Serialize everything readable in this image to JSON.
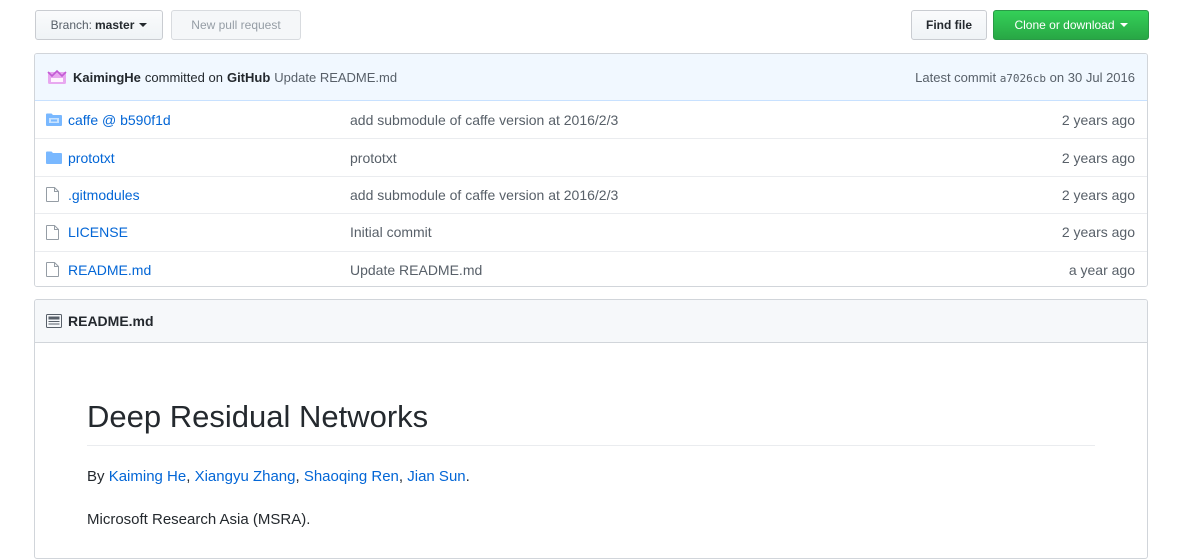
{
  "toolbar": {
    "branch_prefix": "Branch:",
    "branch_value": "master",
    "new_pr_label": "New pull request",
    "find_file_label": "Find file",
    "clone_label": "Clone or download"
  },
  "commit": {
    "author": "KaimingHe",
    "middle": "committed on",
    "platform": "GitHub",
    "message": "Update README.md",
    "latest_prefix": "Latest commit",
    "sha": "a7026cb",
    "date_prefix": "on",
    "date": "30 Jul 2016"
  },
  "files": [
    {
      "icon": "submodule-icon",
      "name": "caffe @ b590f1d",
      "message": "add submodule of caffe version at 2016/2/3",
      "age": "2 years ago"
    },
    {
      "icon": "folder-icon",
      "name": "prototxt",
      "message": "prototxt",
      "age": "2 years ago"
    },
    {
      "icon": "file-icon",
      "name": ".gitmodules",
      "message": "add submodule of caffe version at 2016/2/3",
      "age": "2 years ago"
    },
    {
      "icon": "file-icon",
      "name": "LICENSE",
      "message": "Initial commit",
      "age": "2 years ago"
    },
    {
      "icon": "file-icon",
      "name": "README.md",
      "message": "Update README.md",
      "age": "a year ago"
    }
  ],
  "readme": {
    "file_label": "README.md",
    "title": "Deep Residual Networks",
    "by_prefix": "By",
    "authors": [
      "Kaiming He",
      "Xiangyu Zhang",
      "Shaoqing Ren",
      "Jian Sun"
    ],
    "sep": ",",
    "end": ".",
    "org": "Microsoft Research Asia (MSRA)."
  },
  "colors": {
    "link": "#0366d6",
    "clone_green": "#28a745",
    "commit_bg": "#f1f8ff"
  }
}
